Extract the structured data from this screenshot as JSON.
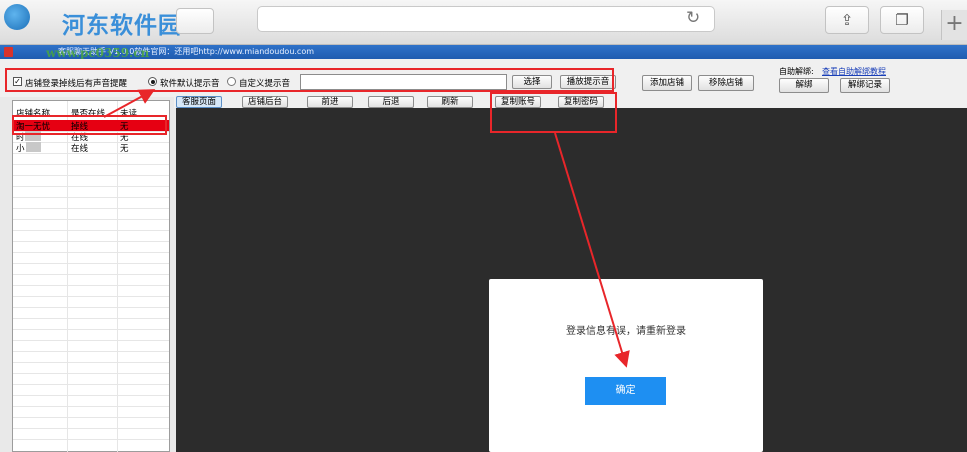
{
  "chrome": {
    "site_logo": "河东软件园",
    "reload_glyph": "↻",
    "share_glyph": "⇪",
    "tabs_glyph": "❐",
    "new_tab_glyph": "+"
  },
  "app": {
    "title": "客服聊天助手 V1.0.0软件官网：还用吧http://www.miandoudou.com",
    "watermark": "www.pc0359.cn"
  },
  "toolbar": {
    "sound_checkbox_label": "店铺登录掉线后有声音提醒",
    "check_glyph": "✓",
    "radio_default_label": "软件默认提示音",
    "radio_custom_label": "自定义提示音",
    "sound_path_value": "",
    "select_button": "选择",
    "play_button": "播放提示音",
    "add_shop_button": "添加店铺",
    "remove_shop_button": "移除店铺",
    "auto_unbind_label": "自助解绑:",
    "tutorial_link": "查看自助解绑教程",
    "unbind_button": "解绑",
    "unbind_log_button": "解绑记录"
  },
  "nav": {
    "service_page": "客服页面",
    "shop_backend": "店铺后台",
    "forward": "前进",
    "back": "后退",
    "refresh": "刷新",
    "copy_account": "复制账号",
    "copy_password": "复制密码"
  },
  "shop_table": {
    "headers": [
      "店铺名称",
      "是否在线",
      "未读"
    ],
    "rows": [
      [
        "淘一无忧",
        "掉线",
        "无"
      ],
      [
        "时",
        "在线",
        "无"
      ],
      [
        "小",
        "在线",
        "无"
      ]
    ]
  },
  "dialog": {
    "message": "登录信息有误，请重新登录",
    "ok_button": "确定"
  },
  "colors": {
    "annotation_red": "#e8262a",
    "selected_row": "#e60012",
    "ok_button": "#1e8ff2",
    "browser_bg": "#2c2c2c"
  }
}
